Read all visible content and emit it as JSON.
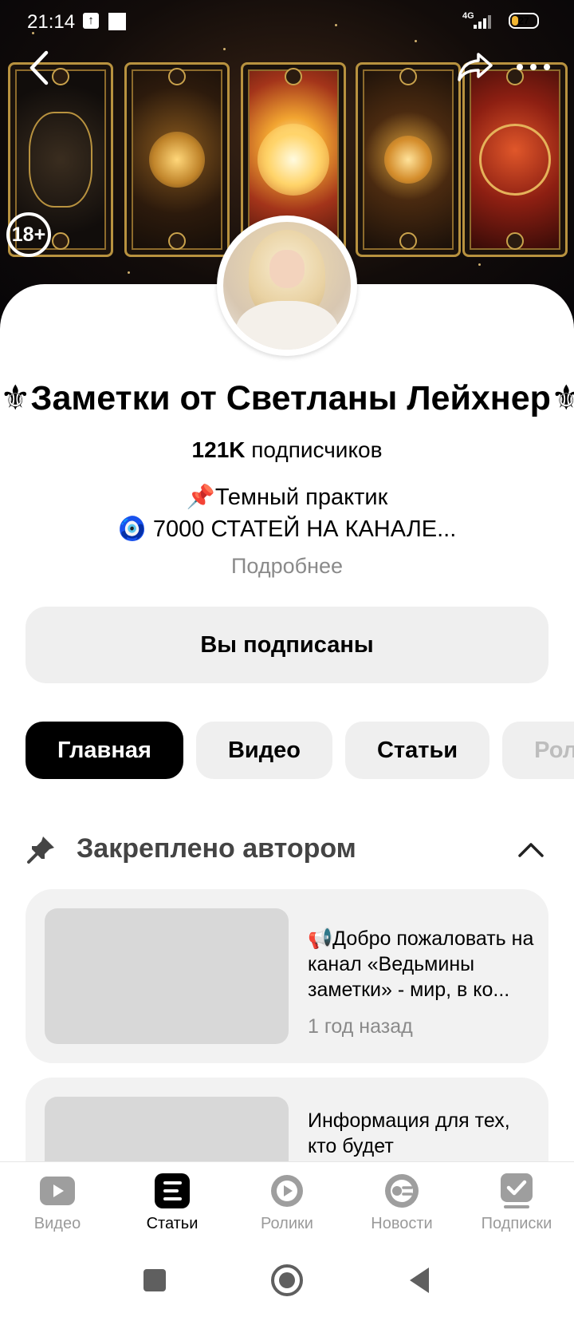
{
  "status_bar": {
    "time": "21:14",
    "network": "4G",
    "battery": "27",
    "battery_level": 0.27
  },
  "header": {
    "age_rating": "18+",
    "back_icon": "chevron-left-icon",
    "share_icon": "share-arrow-icon",
    "more_icon": "more-dots-icon"
  },
  "channel": {
    "title": "⚜Заметки от Светланы Лейхнер⚜",
    "subscribers_count": "121K",
    "subscribers_label": "подписчиков",
    "description_line1": "📌Темный практик",
    "description_line2": "🧿 7000 СТАТЕЙ НА КАНАЛЕ...",
    "more_link": "Подробнее",
    "subscribe_button": "Вы подписаны"
  },
  "tabs": [
    {
      "label": "Главная",
      "active": true
    },
    {
      "label": "Видео",
      "active": false
    },
    {
      "label": "Статьи",
      "active": false
    },
    {
      "label": "Рол",
      "active": false
    }
  ],
  "pinned": {
    "label": "Закреплено автором",
    "articles": [
      {
        "title": "📢Добро пожаловать на канал «Ведьмины заметки» - мир, в ко...",
        "time": "1 год назад"
      },
      {
        "title": "Информация для тех, кто будет",
        "time": ""
      }
    ]
  },
  "bottom_nav": [
    {
      "label": "Видео",
      "icon": "video-play-icon",
      "active": false
    },
    {
      "label": "Статьи",
      "icon": "articles-icon",
      "active": true
    },
    {
      "label": "Ролики",
      "icon": "shorts-icon",
      "active": false
    },
    {
      "label": "Новости",
      "icon": "news-icon",
      "active": false
    },
    {
      "label": "Подписки",
      "icon": "subscriptions-icon",
      "active": false
    }
  ],
  "colors": {
    "accent": "#000000",
    "muted_text": "#8a8a8a",
    "chip_bg": "#efefef",
    "card_bg": "#f2f2f2",
    "battery": "#f2b632"
  }
}
